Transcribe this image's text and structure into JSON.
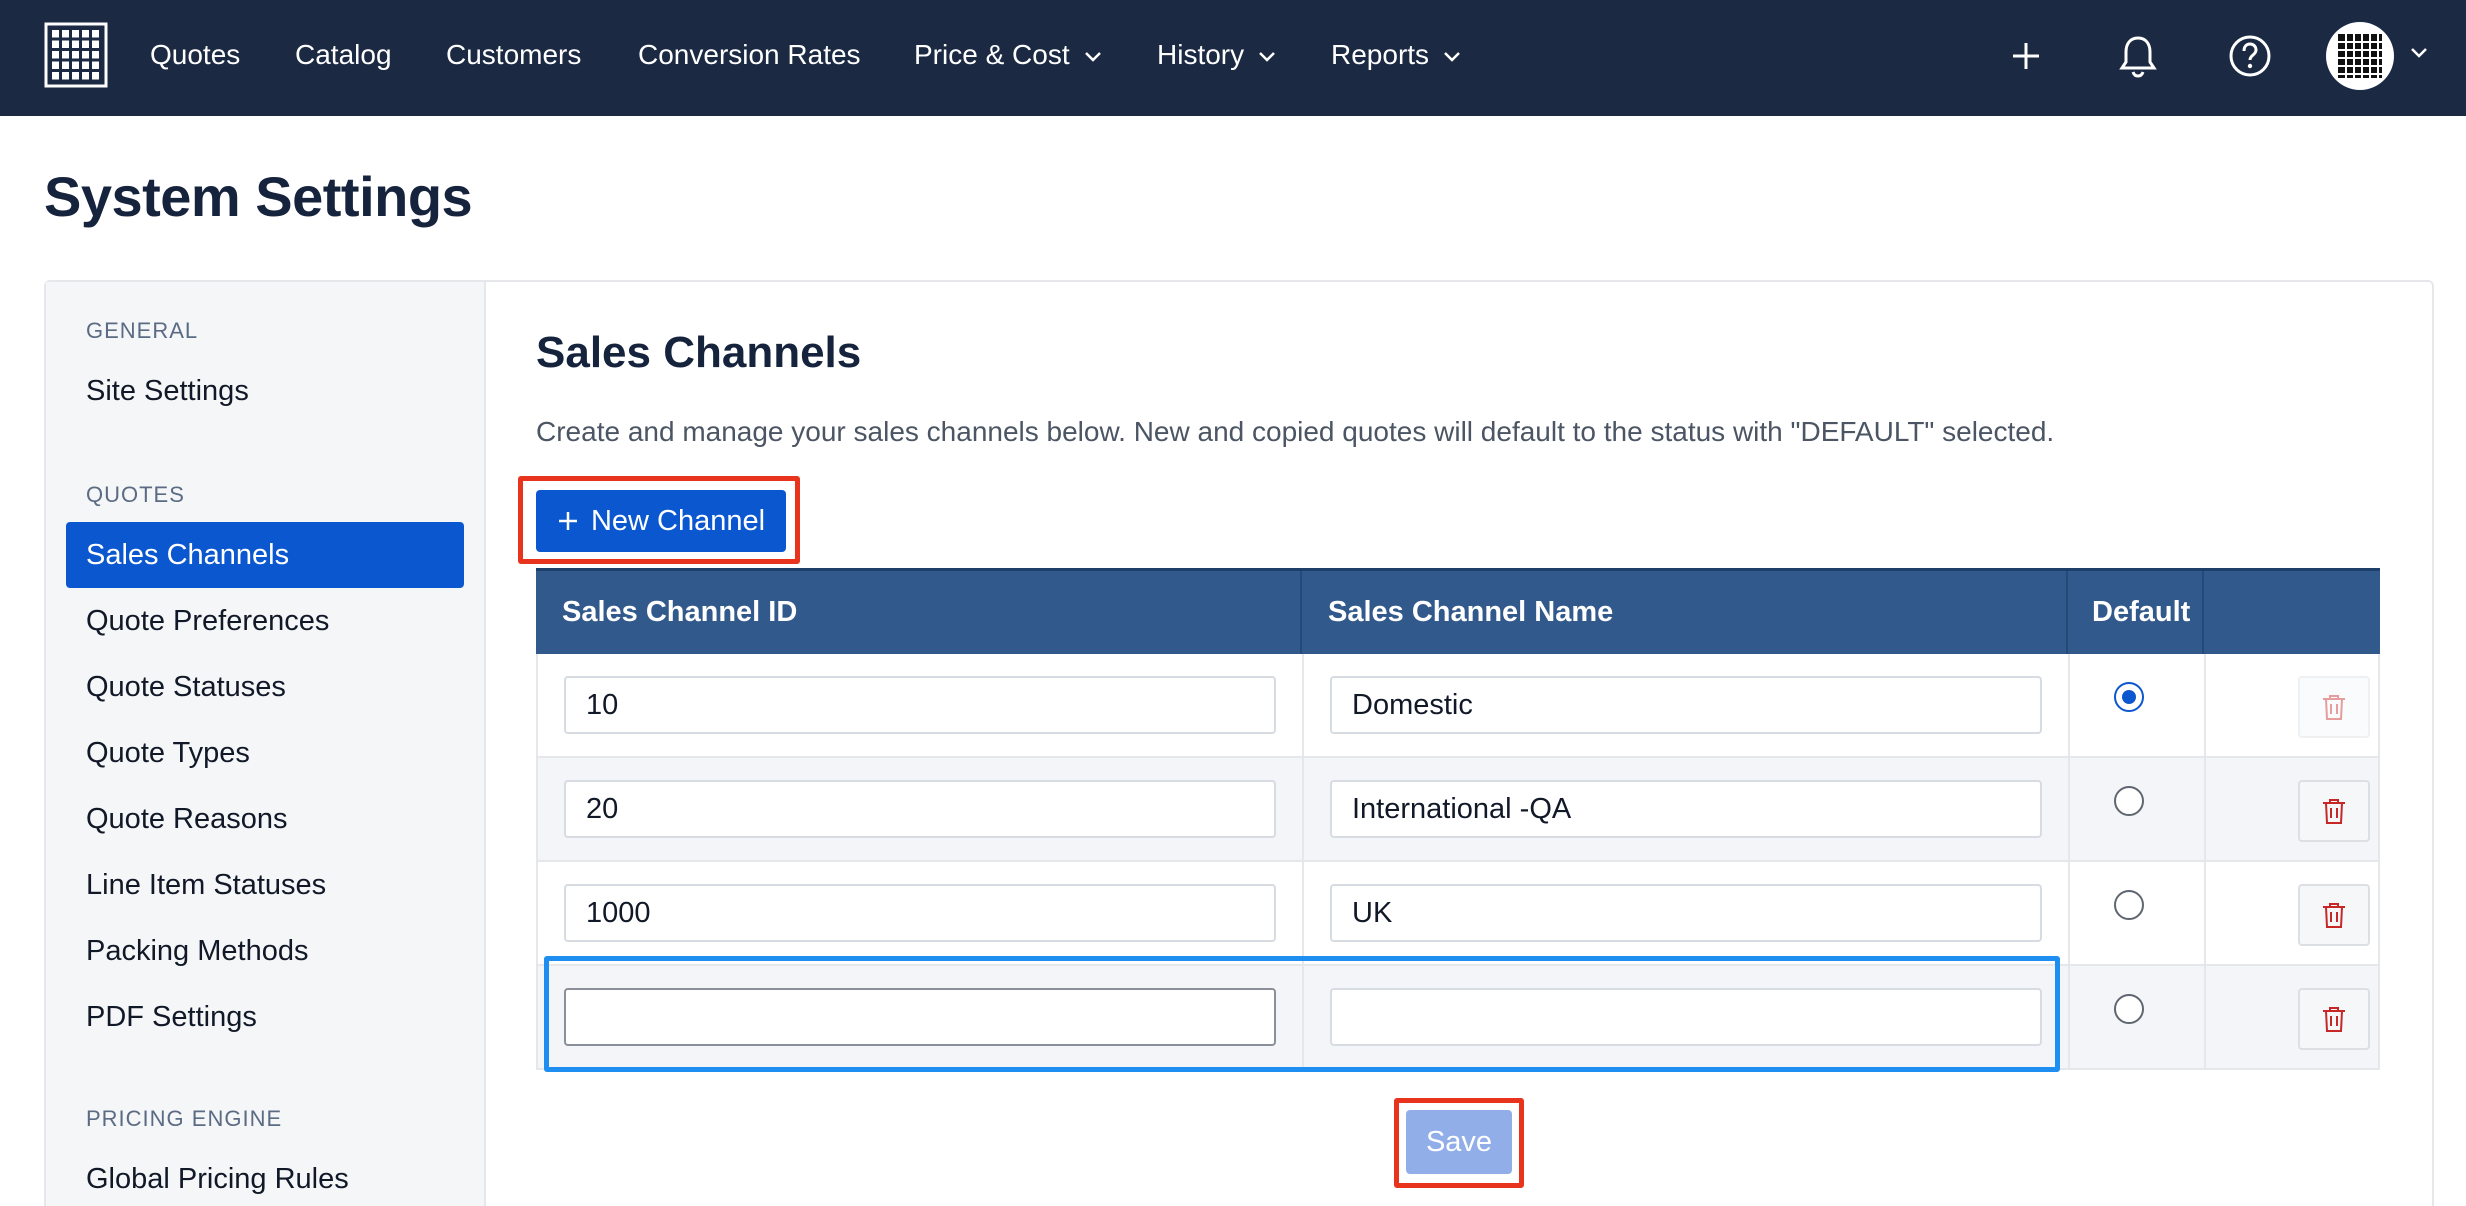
{
  "nav": {
    "items": [
      {
        "label": "Quotes",
        "dropdown": false
      },
      {
        "label": "Catalog",
        "dropdown": false
      },
      {
        "label": "Customers",
        "dropdown": false
      },
      {
        "label": "Conversion Rates",
        "dropdown": false
      },
      {
        "label": "Price & Cost",
        "dropdown": true
      },
      {
        "label": "History",
        "dropdown": true
      },
      {
        "label": "Reports",
        "dropdown": true
      }
    ],
    "icons": [
      "plus-icon",
      "bell-icon",
      "help-icon",
      "avatar-grid-icon"
    ],
    "colors": {
      "background": "#1b2943",
      "text": "#ffffff"
    }
  },
  "page": {
    "title": "System Settings"
  },
  "sidebar": {
    "sections": [
      {
        "heading": "GENERAL",
        "items": [
          "Site Settings"
        ]
      },
      {
        "heading": "QUOTES",
        "items": [
          "Sales Channels",
          "Quote Preferences",
          "Quote Statuses",
          "Quote Types",
          "Quote Reasons",
          "Line Item Statuses",
          "Packing Methods",
          "PDF Settings"
        ]
      },
      {
        "heading": "PRICING ENGINE",
        "items": [
          "Global Pricing Rules"
        ]
      }
    ],
    "active_item": "Sales Channels",
    "colors": {
      "active_bg": "#0b57d0"
    }
  },
  "main": {
    "title": "Sales Channels",
    "description": "Create and manage your sales channels below. New and copied quotes will default to the status with \"DEFAULT\" selected.",
    "new_button_label": "New Channel",
    "table": {
      "headers": [
        "Sales Channel ID",
        "Sales Channel Name",
        "Default",
        ""
      ],
      "rows": [
        {
          "id": "10",
          "name": "Domestic",
          "default": true,
          "delete_enabled": false
        },
        {
          "id": "20",
          "name": "International -QA",
          "default": false,
          "delete_enabled": true
        },
        {
          "id": "1000",
          "name": "UK",
          "default": false,
          "delete_enabled": true
        },
        {
          "id": "",
          "name": "",
          "default": false,
          "delete_enabled": true
        }
      ]
    },
    "save_label": "Save",
    "colors": {
      "header_bg": "#32598b",
      "primary": "#0b57d0",
      "save_disabled": "#91aee8",
      "annotation_red": "#e8341c",
      "annotation_blue": "#1e8ff0",
      "trash": "#c62828"
    }
  }
}
